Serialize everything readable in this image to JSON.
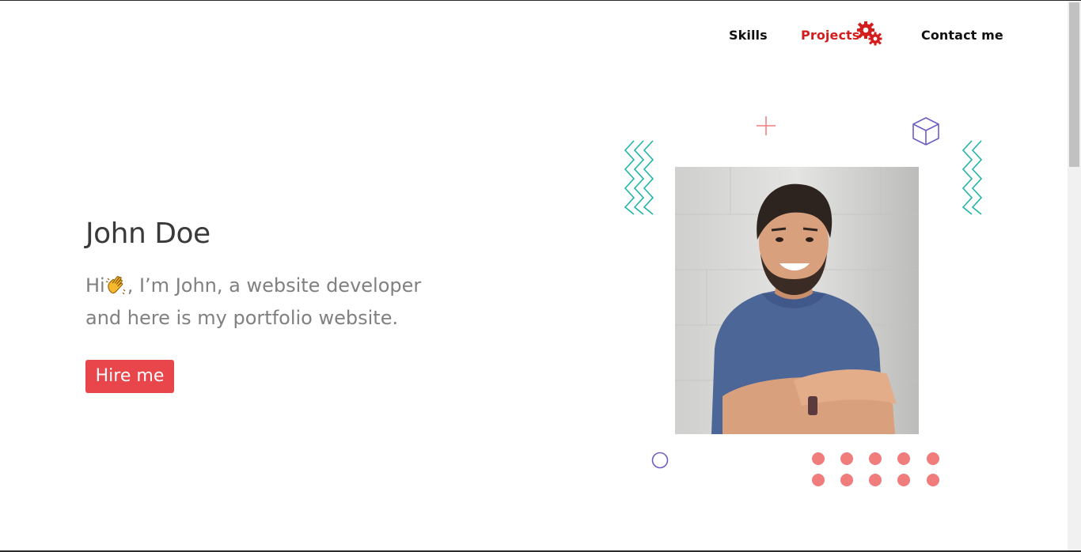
{
  "nav": {
    "skills": "Skills",
    "projects": "Projects",
    "contact": "Contact me"
  },
  "hero": {
    "name": "John Doe",
    "intro_before": "Hi",
    "intro_after": ", I’m John, a website developer and here is my portfolio website.",
    "hire_label": "Hire me"
  },
  "colors": {
    "accent": "#e8464b",
    "nav_active": "#d41e1e",
    "teal": "#1fb5a8",
    "purple": "#6b5fc4",
    "coral": "#f07c7c"
  },
  "icons": {
    "gears": "gears-icon",
    "wave": "waving-hand-icon"
  }
}
